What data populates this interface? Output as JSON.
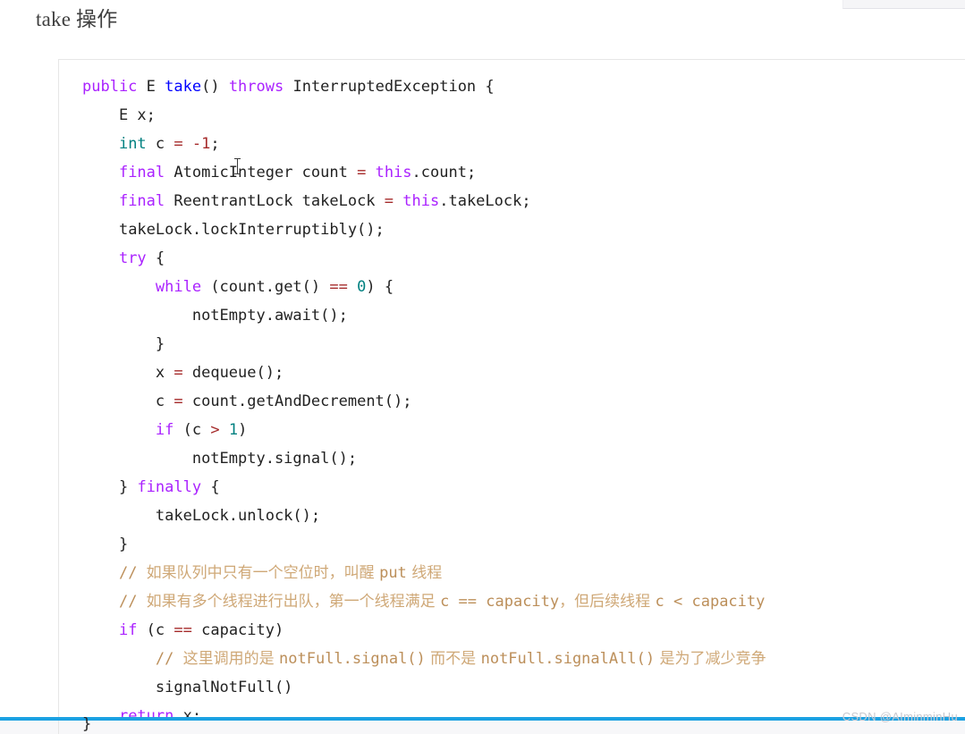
{
  "page": {
    "title": "take 操作",
    "watermark": "CSDN @AIminminHu"
  },
  "colors": {
    "keyword": "#aa22ff",
    "type": "#008080",
    "function": "#0000ff",
    "operator": "#a52a2a",
    "number": "#008080",
    "comment": "#bc8f5a",
    "comment_cjk": "#cfa877",
    "plain": "#222222",
    "accent_bar": "#1ba1e2",
    "code_border": "#e6e6e6",
    "watermark": "#c9c9cf"
  },
  "code": {
    "language": "java",
    "lines": [
      {
        "indent": 0,
        "tokens": [
          {
            "t": "public",
            "c": "kw"
          },
          {
            "t": " E ",
            "c": "plain"
          },
          {
            "t": "take",
            "c": "fn"
          },
          {
            "t": "() ",
            "c": "plain"
          },
          {
            "t": "throws",
            "c": "kw"
          },
          {
            "t": " InterruptedException {",
            "c": "plain"
          }
        ]
      },
      {
        "indent": 1,
        "tokens": [
          {
            "t": "E x;",
            "c": "plain"
          }
        ]
      },
      {
        "indent": 1,
        "tokens": [
          {
            "t": "int",
            "c": "type"
          },
          {
            "t": " c ",
            "c": "plain"
          },
          {
            "t": "=",
            "c": "op"
          },
          {
            "t": " ",
            "c": "plain"
          },
          {
            "t": "-1",
            "c": "op"
          },
          {
            "t": ";",
            "c": "plain"
          }
        ]
      },
      {
        "indent": 1,
        "tokens": [
          {
            "t": "final",
            "c": "kw"
          },
          {
            "t": " AtomicInteger count ",
            "c": "plain"
          },
          {
            "t": "=",
            "c": "op"
          },
          {
            "t": " ",
            "c": "plain"
          },
          {
            "t": "this",
            "c": "this"
          },
          {
            "t": ".count;",
            "c": "plain"
          }
        ]
      },
      {
        "indent": 1,
        "tokens": [
          {
            "t": "final",
            "c": "kw"
          },
          {
            "t": " ReentrantLock takeLock ",
            "c": "plain"
          },
          {
            "t": "=",
            "c": "op"
          },
          {
            "t": " ",
            "c": "plain"
          },
          {
            "t": "this",
            "c": "this"
          },
          {
            "t": ".takeLock;",
            "c": "plain"
          }
        ]
      },
      {
        "indent": 1,
        "tokens": [
          {
            "t": "takeLock.lockInterruptibly();",
            "c": "plain"
          }
        ]
      },
      {
        "indent": 1,
        "tokens": [
          {
            "t": "try",
            "c": "kw"
          },
          {
            "t": " {",
            "c": "plain"
          }
        ]
      },
      {
        "indent": 2,
        "tokens": [
          {
            "t": "while",
            "c": "kw"
          },
          {
            "t": " (count.get() ",
            "c": "plain"
          },
          {
            "t": "==",
            "c": "op"
          },
          {
            "t": " ",
            "c": "plain"
          },
          {
            "t": "0",
            "c": "num"
          },
          {
            "t": ") {",
            "c": "plain"
          }
        ]
      },
      {
        "indent": 3,
        "tokens": [
          {
            "t": "notEmpty.await();",
            "c": "plain"
          }
        ]
      },
      {
        "indent": 2,
        "tokens": [
          {
            "t": "}",
            "c": "plain"
          }
        ]
      },
      {
        "indent": 2,
        "tokens": [
          {
            "t": "x ",
            "c": "plain"
          },
          {
            "t": "=",
            "c": "op"
          },
          {
            "t": " dequeue();",
            "c": "plain"
          }
        ]
      },
      {
        "indent": 2,
        "tokens": [
          {
            "t": "c ",
            "c": "plain"
          },
          {
            "t": "=",
            "c": "op"
          },
          {
            "t": " count.getAndDecrement();",
            "c": "plain"
          }
        ]
      },
      {
        "indent": 2,
        "tokens": [
          {
            "t": "if",
            "c": "kw"
          },
          {
            "t": " (c ",
            "c": "plain"
          },
          {
            "t": ">",
            "c": "op"
          },
          {
            "t": " ",
            "c": "plain"
          },
          {
            "t": "1",
            "c": "num"
          },
          {
            "t": ")",
            "c": "plain"
          }
        ]
      },
      {
        "indent": 3,
        "tokens": [
          {
            "t": "notEmpty.signal();",
            "c": "plain"
          }
        ]
      },
      {
        "indent": 1,
        "tokens": [
          {
            "t": "} ",
            "c": "plain"
          },
          {
            "t": "finally",
            "c": "kw"
          },
          {
            "t": " {",
            "c": "plain"
          }
        ]
      },
      {
        "indent": 2,
        "tokens": [
          {
            "t": "takeLock.unlock();",
            "c": "plain"
          }
        ]
      },
      {
        "indent": 1,
        "tokens": [
          {
            "t": "}",
            "c": "plain"
          }
        ]
      },
      {
        "indent": 1,
        "tokens": [
          {
            "t": "// ",
            "c": "comment"
          },
          {
            "t": "如果队列中只有一个空位时，叫醒 ",
            "c": "comment-cjk"
          },
          {
            "t": "put",
            "c": "comment"
          },
          {
            "t": " 线程",
            "c": "comment-cjk"
          }
        ]
      },
      {
        "indent": 1,
        "tokens": [
          {
            "t": "// ",
            "c": "comment"
          },
          {
            "t": "如果有多个线程进行出队，第一个线程满足 ",
            "c": "comment-cjk"
          },
          {
            "t": "c == capacity",
            "c": "comment"
          },
          {
            "t": "，但后续线程 ",
            "c": "comment-cjk"
          },
          {
            "t": "c < capacity",
            "c": "comment"
          }
        ]
      },
      {
        "indent": 1,
        "tokens": [
          {
            "t": "if",
            "c": "kw"
          },
          {
            "t": " (c ",
            "c": "plain"
          },
          {
            "t": "==",
            "c": "op"
          },
          {
            "t": " capacity)",
            "c": "plain"
          }
        ]
      },
      {
        "indent": 2,
        "tokens": [
          {
            "t": "// ",
            "c": "comment"
          },
          {
            "t": "这里调用的是 ",
            "c": "comment-cjk"
          },
          {
            "t": "notFull.signal()",
            "c": "comment"
          },
          {
            "t": " 而不是 ",
            "c": "comment-cjk"
          },
          {
            "t": "notFull.signalAll()",
            "c": "comment"
          },
          {
            "t": " 是为了减少竞争",
            "c": "comment-cjk"
          }
        ]
      },
      {
        "indent": 2,
        "tokens": [
          {
            "t": "signalNotFull()",
            "c": "plain"
          }
        ]
      },
      {
        "indent": 1,
        "tokens": [
          {
            "t": "return",
            "c": "kw"
          },
          {
            "t": " x;",
            "c": "plain"
          }
        ]
      }
    ],
    "tail_line": "}"
  }
}
